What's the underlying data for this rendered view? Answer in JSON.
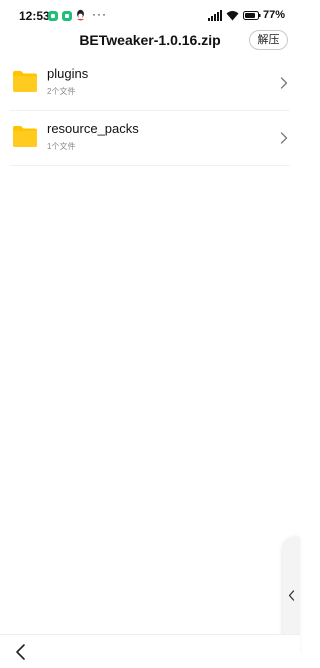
{
  "status_bar": {
    "time": "12:53",
    "more": "···",
    "battery_text": "77%",
    "icons": [
      "app-notification-icon",
      "app-notification-icon",
      "qq-icon",
      "signal-icon",
      "wifi-icon",
      "battery-icon"
    ]
  },
  "title_bar": {
    "title": "BETweaker-1.0.16.zip",
    "extract_label": "解压"
  },
  "files": [
    {
      "name": "plugins",
      "meta": "2个文件",
      "icon": "folder-icon"
    },
    {
      "name": "resource_packs",
      "meta": "1个文件",
      "icon": "folder-icon"
    }
  ],
  "colors": {
    "folder": "#FFC300",
    "accent_green": "#1FBF7A"
  }
}
